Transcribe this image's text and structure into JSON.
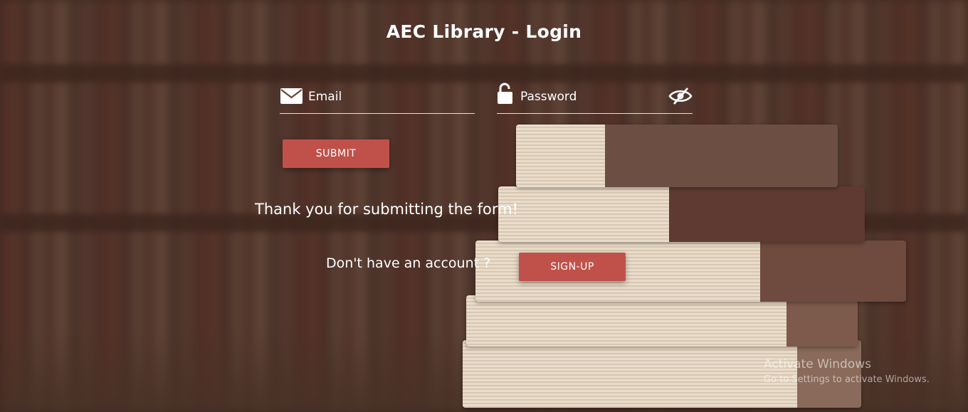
{
  "header": {
    "title": "AEC Library - Login"
  },
  "form": {
    "email_placeholder": "Email",
    "password_placeholder": "Password",
    "submit_label": "SUBMIT",
    "icons": {
      "email": "envelope-icon",
      "password": "unlock-icon",
      "toggle": "eye-slash-icon"
    }
  },
  "message": {
    "thanks": "Thank you for submitting the form!"
  },
  "signup": {
    "prompt": "Don't have an account ?",
    "button_label": "SIGN-UP"
  },
  "watermark": {
    "title": "Activate Windows",
    "subtitle": "Go to Settings to activate Windows."
  },
  "colors": {
    "accent": "#c0514a",
    "text": "#ffffff"
  }
}
